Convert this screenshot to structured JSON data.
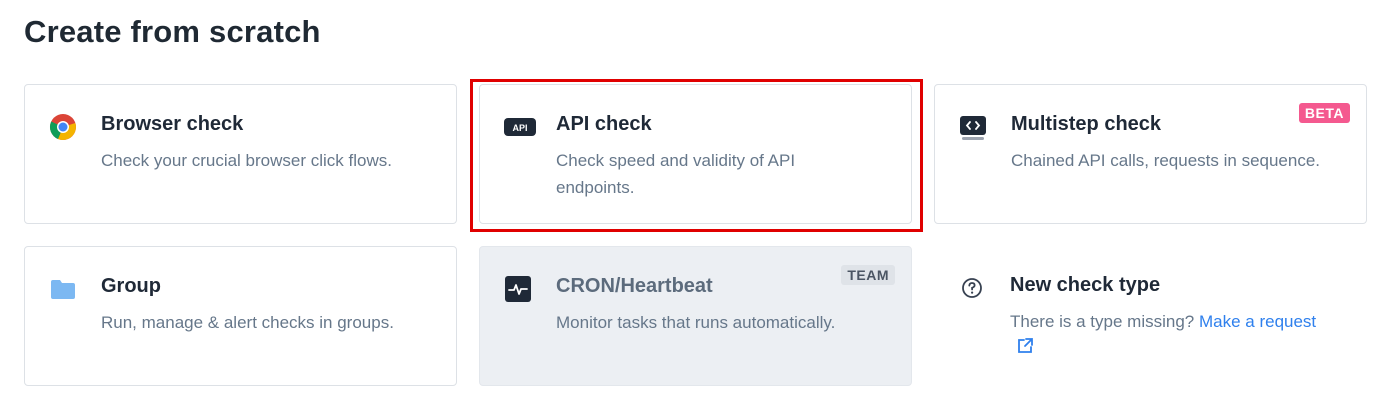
{
  "page": {
    "title": "Create from scratch"
  },
  "cards": {
    "browser": {
      "title": "Browser check",
      "desc": "Check your crucial browser click flows.",
      "icon": "chrome-icon"
    },
    "api": {
      "title": "API check",
      "desc": "Check speed and validity of API endpoints.",
      "icon": "api-icon",
      "icon_text": "API",
      "highlighted": true
    },
    "multistep": {
      "title": "Multistep check",
      "desc": "Chained API calls, requests in sequence.",
      "icon": "code-window-icon",
      "badge": "BETA"
    },
    "group": {
      "title": "Group",
      "desc": "Run, manage & alert checks in groups.",
      "icon": "folder-icon"
    },
    "cron": {
      "title": "CRON/Heartbeat",
      "desc": "Monitor tasks that runs automatically.",
      "icon": "heartbeat-icon",
      "badge": "TEAM"
    },
    "newtype": {
      "title": "New check type",
      "desc_prefix": "There is a type missing?",
      "link_text": "Make a request",
      "icon": "question-circle-icon",
      "link_icon": "external-link-icon"
    }
  },
  "colors": {
    "highlight": "#e00000",
    "beta_badge": "#f4598f",
    "link": "#2f80ed",
    "disabled_card": "#eceff3"
  }
}
